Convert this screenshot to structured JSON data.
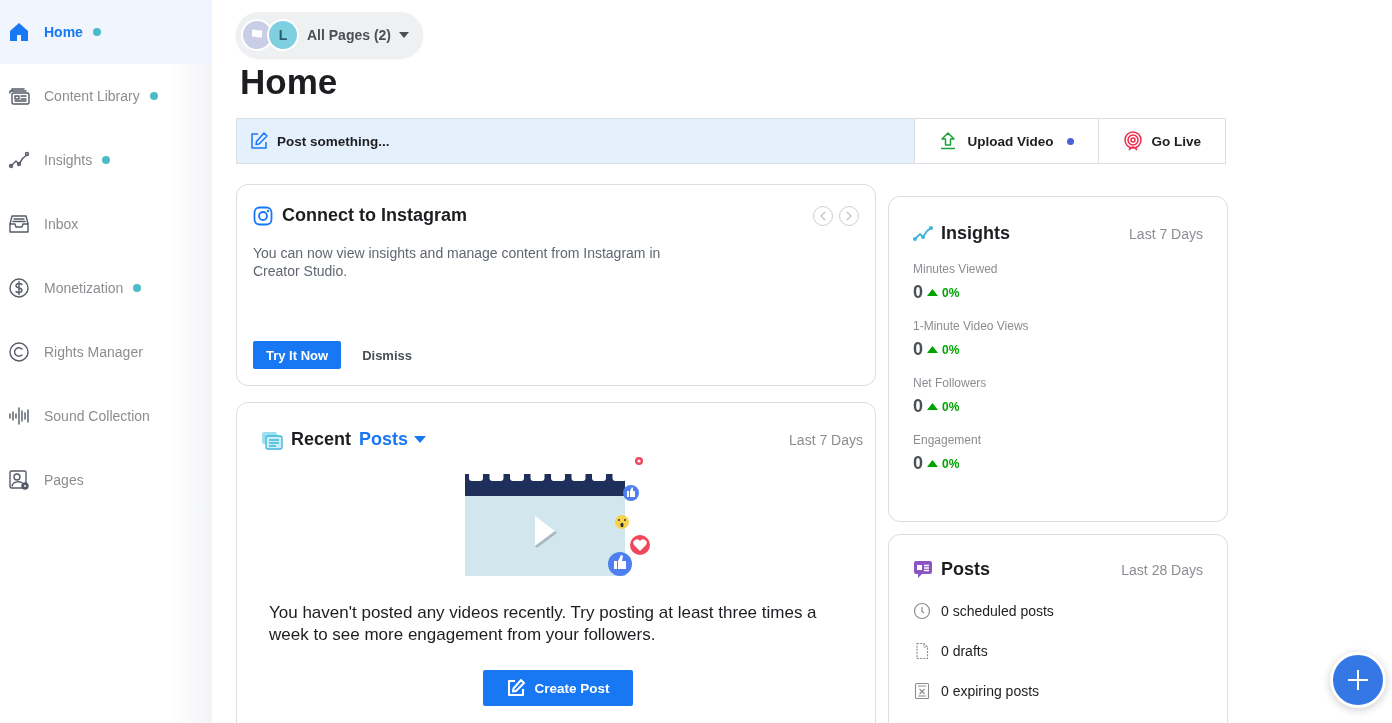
{
  "sidebar": {
    "items": [
      {
        "label": "Home",
        "selected": true,
        "dot": true
      },
      {
        "label": "Content Library",
        "selected": false,
        "dot": true
      },
      {
        "label": "Insights",
        "selected": false,
        "dot": true
      },
      {
        "label": "Inbox",
        "selected": false,
        "dot": false
      },
      {
        "label": "Monetization",
        "selected": false,
        "dot": true
      },
      {
        "label": "Rights Manager",
        "selected": false,
        "dot": false
      },
      {
        "label": "Sound Collection",
        "selected": false,
        "dot": false
      },
      {
        "label": "Pages",
        "selected": false,
        "dot": false
      }
    ]
  },
  "page_switcher": {
    "avatar_letter": "L",
    "label": "All Pages (2)"
  },
  "title": "Home",
  "composer": {
    "label": "Post something...",
    "actions": [
      {
        "label": "Upload Video",
        "dot": true
      },
      {
        "label": "Go Live",
        "dot": false
      }
    ]
  },
  "connect_card": {
    "title": "Connect to Instagram",
    "body": "You can now view insights and manage content from Instagram in Creator Studio.",
    "primary": "Try It Now",
    "secondary": "Dismiss"
  },
  "recent_posts": {
    "title": "Recent",
    "filter": "Posts",
    "period": "Last 7 Days",
    "message": "You haven't posted any videos recently. Try posting at least three times a week to see more engagement from your followers.",
    "button": "Create Post"
  },
  "insights": {
    "title": "Insights",
    "period": "Last 7 Days",
    "metrics": [
      {
        "label": "Minutes Viewed",
        "value": "0",
        "change": "0%",
        "rising": true
      },
      {
        "label": "1-Minute Video Views",
        "value": "0",
        "change": "0%",
        "rising": true
      },
      {
        "label": "Net Followers",
        "value": "0",
        "change": "0%",
        "rising": true
      },
      {
        "label": "Engagement",
        "value": "0",
        "change": "0%",
        "rising": true
      }
    ]
  },
  "posts_summary": {
    "title": "Posts",
    "period": "Last 28 Days",
    "items": [
      "0 scheduled posts",
      "0 drafts",
      "0 expiring posts"
    ]
  }
}
